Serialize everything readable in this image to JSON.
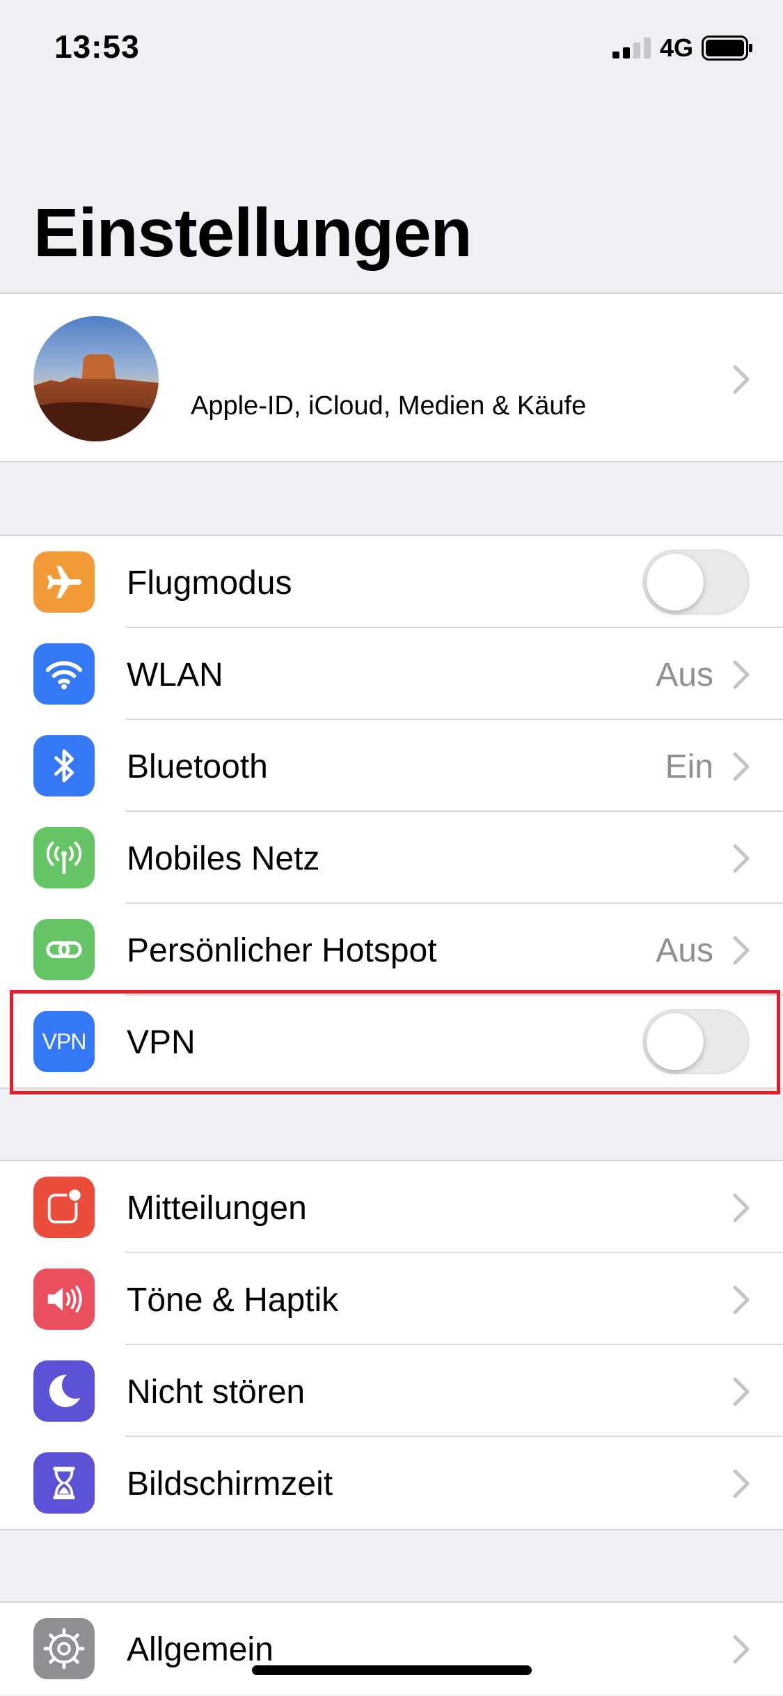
{
  "status_bar": {
    "time": "13:53",
    "network": "4G"
  },
  "page": {
    "title": "Einstellungen"
  },
  "profile": {
    "subtitle": "Apple-ID, iCloud, Medien & Käufe"
  },
  "connectivity": [
    {
      "label": "Flugmodus",
      "icon": "airplane-icon",
      "color": "#f19a37",
      "control": "toggle",
      "toggle_on": false
    },
    {
      "label": "WLAN",
      "icon": "wifi-icon",
      "color": "#3478f6",
      "value": "Aus"
    },
    {
      "label": "Bluetooth",
      "icon": "bluetooth-icon",
      "color": "#3478f6",
      "value": "Ein"
    },
    {
      "label": "Mobiles Netz",
      "icon": "antenna-icon",
      "color": "#65c466"
    },
    {
      "label": "Persönlicher Hotspot",
      "icon": "hotspot-icon",
      "color": "#65c466",
      "value": "Aus"
    },
    {
      "label": "VPN",
      "icon_text": "VPN",
      "icon": "vpn-icon",
      "color": "#3478f6",
      "control": "toggle",
      "toggle_on": false
    }
  ],
  "notifications": [
    {
      "label": "Mitteilungen",
      "icon": "notifications-icon",
      "color": "#eb4d3d"
    },
    {
      "label": "Töne & Haptik",
      "icon": "speaker-icon",
      "color": "#eb4e5e"
    },
    {
      "label": "Nicht stören",
      "icon": "moon-icon",
      "color": "#5b52d6"
    },
    {
      "label": "Bildschirmzeit",
      "icon": "hourglass-icon",
      "color": "#5b52d6"
    }
  ],
  "general": [
    {
      "label": "Allgemein",
      "icon": "gear-icon",
      "color": "#8e8e93"
    }
  ]
}
